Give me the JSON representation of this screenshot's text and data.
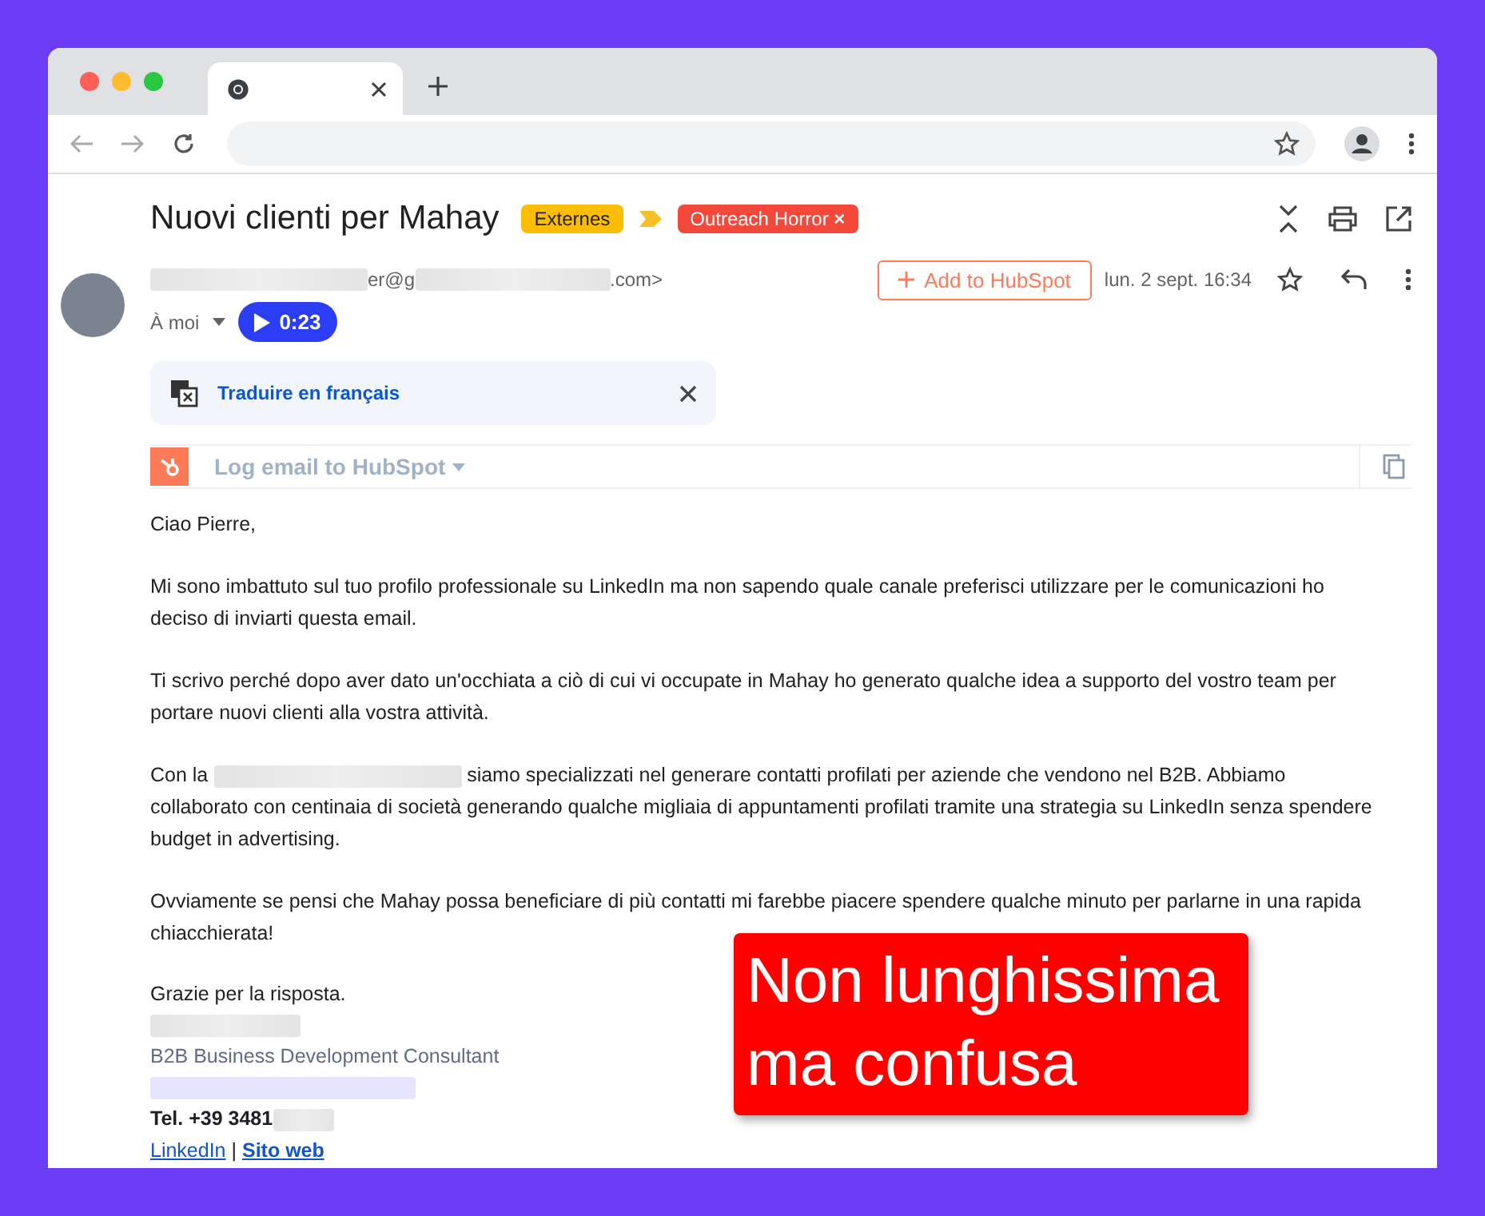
{
  "email": {
    "subject": "Nuovi clienti per Mahay",
    "labels": [
      {
        "text": "Externes",
        "color": "#fbbc04"
      },
      {
        "text": "Outreach Horror",
        "color": "#f4483a",
        "remove": "×"
      }
    ],
    "sender": {
      "address_start": "er@g",
      "address_end": ".com>"
    },
    "recipient": "À moi",
    "voice_note": "0:23",
    "add_button": "Add to HubSpot",
    "date": "lun. 2 sept. 16:34",
    "translate": "Traduire en français",
    "hubspot_log": "Log email to HubSpot",
    "paragraphs": [
      {
        "kind": "plain",
        "text": "Ciao Pierre,"
      },
      {
        "kind": "plain",
        "text": "Mi sono imbattuto sul tuo profilo professionale su LinkedIn ma non sapendo quale canale preferisci utilizzare per le comunicazioni ho deciso di inviarti questa email."
      },
      {
        "kind": "plain",
        "text": "Ti scrivo perché dopo aver dato un'occhiata a ciò di cui vi occupate in Mahay ho generato qualche idea a supporto del vostro team per portare nuovi clienti alla vostra attività."
      },
      {
        "kind": "redacted",
        "before": "Con la",
        "after": "siamo specializzati nel generare contatti profilati per aziende che vendono nel B2B. Abbiamo collaborato con centinaia di società generando qualche migliaia di appuntamenti profilati tramite una strategia su LinkedIn senza spendere budget in advertising."
      },
      {
        "kind": "plain",
        "text": "Ovviamente se pensi che Mahay possa beneficiare di più contatti mi farebbe piacere spendere qualche minuto per parlarne in una rapida chiacchierata!"
      }
    ],
    "signature": {
      "closing": "Grazie per la risposta.",
      "role": "B2B Business Development Consultant",
      "phone": "Tel. +39 3481",
      "links": [
        "LinkedIn",
        "Sito web"
      ],
      "separator": "|"
    }
  },
  "note": "Non lunghissima ma confusa"
}
